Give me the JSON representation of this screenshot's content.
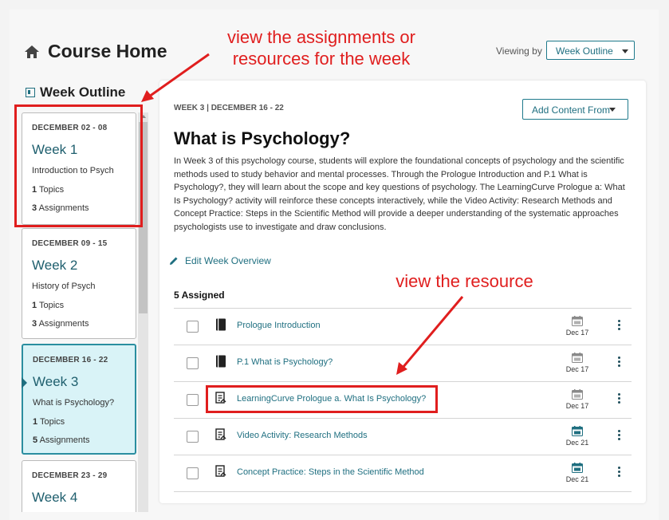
{
  "header": {
    "title": "Course Home",
    "viewing_label": "Viewing by",
    "viewing_value": "Week Outline"
  },
  "sidebar": {
    "heading": "Week Outline",
    "weeks": [
      {
        "date": "DECEMBER 02 - 08",
        "title": "Week 1",
        "subtitle": "Introduction to Psych",
        "topics_count": "1",
        "topics_label": "Topics",
        "assign_count": "3",
        "assign_label": "Assignments"
      },
      {
        "date": "DECEMBER 09 - 15",
        "title": "Week 2",
        "subtitle": "History of Psych",
        "topics_count": "1",
        "topics_label": "Topics",
        "assign_count": "3",
        "assign_label": "Assignments"
      },
      {
        "date": "DECEMBER 16 - 22",
        "title": "Week 3",
        "subtitle": "What is Psychology?",
        "topics_count": "1",
        "topics_label": "Topics",
        "assign_count": "5",
        "assign_label": "Assignments",
        "active": true
      },
      {
        "date": "DECEMBER 23 - 29",
        "title": "Week 4"
      }
    ]
  },
  "main": {
    "date": "WEEK 3 | DECEMBER 16 - 22",
    "add_button": "Add Content From",
    "title": "What is Psychology?",
    "description": "In Week 3 of this psychology course, students will explore the foundational concepts of psychology and the scientific methods used to study behavior and mental processes. Through the Prologue Introduction and P.1 What is Psychology?, they will learn about the scope and key questions of psychology. The LearningCurve Prologue a: What Is Psychology? activity will reinforce these concepts interactively, while the Video Activity: Research Methods and Concept Practice: Steps in the Scientific Method will provide a deeper understanding of the systematic approaches psychologists use to investigate and draw conclusions.",
    "edit_link": "Edit Week Overview",
    "assigned_heading": "5 Assigned",
    "items": [
      {
        "title": "Prologue Introduction",
        "date": "Dec 17",
        "icon": "book-icon",
        "cal_color": "#8a8a8a"
      },
      {
        "title": "P.1 What is Psychology?",
        "date": "Dec 17",
        "icon": "book-icon",
        "cal_color": "#8a8a8a"
      },
      {
        "title": "LearningCurve Prologue a. What Is Psychology?",
        "date": "Dec 17",
        "icon": "assignment-icon",
        "cal_color": "#8a8a8a"
      },
      {
        "title": "Video Activity: Research Methods",
        "date": "Dec 21",
        "icon": "assignment-icon",
        "cal_color": "#1f6f80"
      },
      {
        "title": "Concept Practice: Steps in the Scientific Method",
        "date": "Dec 21",
        "icon": "assignment-icon",
        "cal_color": "#1f6f80"
      }
    ]
  },
  "annotations": {
    "top": "view the assignments or resources for the week",
    "resource": "view the resource"
  },
  "colors": {
    "accent": "#1f6f80",
    "active_bg": "#d9f3f7",
    "annotation": "#e01e1e"
  }
}
